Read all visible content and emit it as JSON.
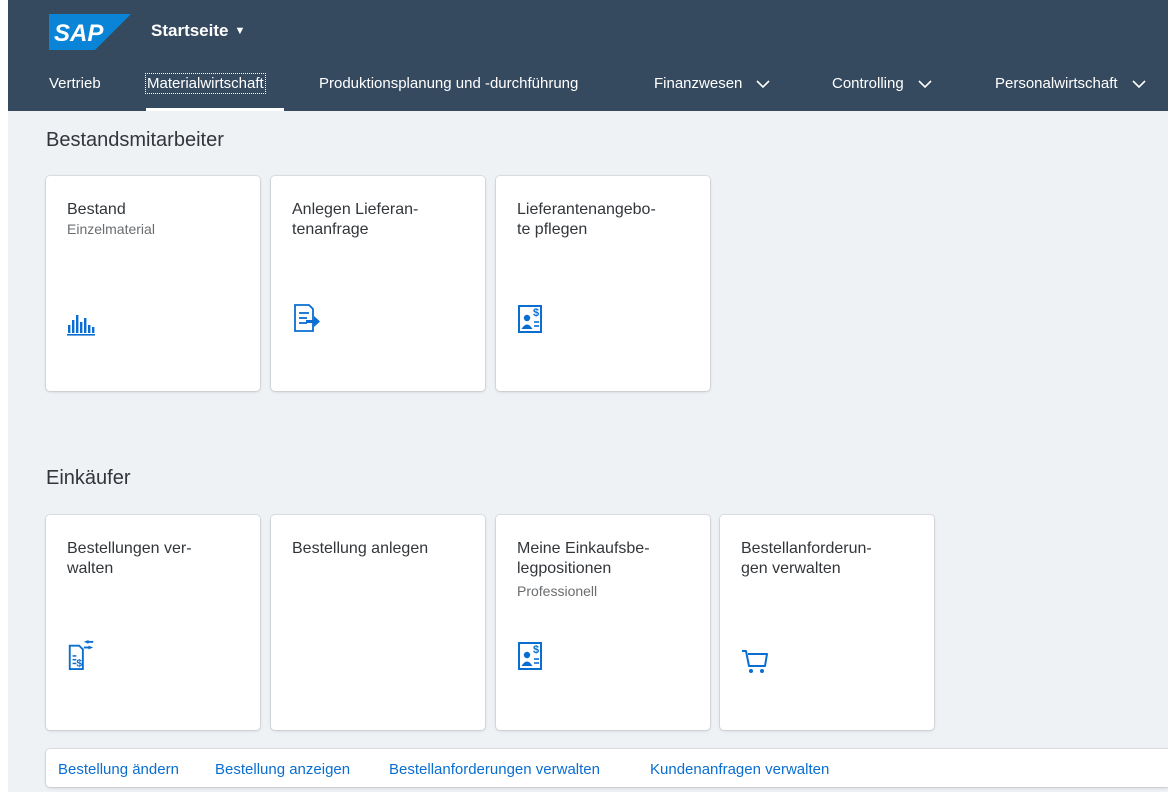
{
  "header": {
    "logo_text": "SAP",
    "home_title": "Startseite",
    "home_caret": "▼",
    "brand_color": "#354a5f",
    "logo_color": "#0a84d6"
  },
  "tabs": [
    {
      "label": "Vertrieb",
      "has_dropdown": false
    },
    {
      "label": "Materialwirtschaft",
      "has_dropdown": false,
      "selected": true
    },
    {
      "label": "Produktionsplanung und -durchführung",
      "has_dropdown": false
    },
    {
      "label": "Finanzwesen",
      "has_dropdown": true
    },
    {
      "label": "Controlling",
      "has_dropdown": true
    },
    {
      "label": "Personalwirtschaft",
      "has_dropdown": true
    }
  ],
  "groups": [
    {
      "title": "Bestandsmitarbeiter",
      "tiles": [
        {
          "title": "Bestand",
          "subtitle": "Einzelmaterial",
          "icon": "bar-chart-icon"
        },
        {
          "title": "Anlegen Lieferan-\ntenanfrage",
          "subtitle": "",
          "icon": "request-list-icon"
        },
        {
          "title": "Lieferantenangebo-\nte pflegen",
          "subtitle": "",
          "icon": "supplier-quote-icon"
        }
      ]
    },
    {
      "title": "Einkäufer",
      "tiles": [
        {
          "title": "Bestellungen ver-\nwalten",
          "subtitle": "",
          "icon": "purchase-order-icon"
        },
        {
          "title": "Bestellung anlegen",
          "subtitle": "",
          "icon": ""
        },
        {
          "title": "Meine Einkaufsbe-\nlegpositionen",
          "subtitle": "Professionell",
          "icon": "supplier-quote-icon"
        },
        {
          "title": "Bestellanforderun-\ngen verwalten",
          "subtitle": "",
          "icon": "shopping-cart-icon"
        }
      ]
    }
  ],
  "links": [
    "Bestellung ändern",
    "Bestellung anzeigen",
    "Bestellanforderungen verwalten",
    "Kundenanfragen verwalten"
  ]
}
